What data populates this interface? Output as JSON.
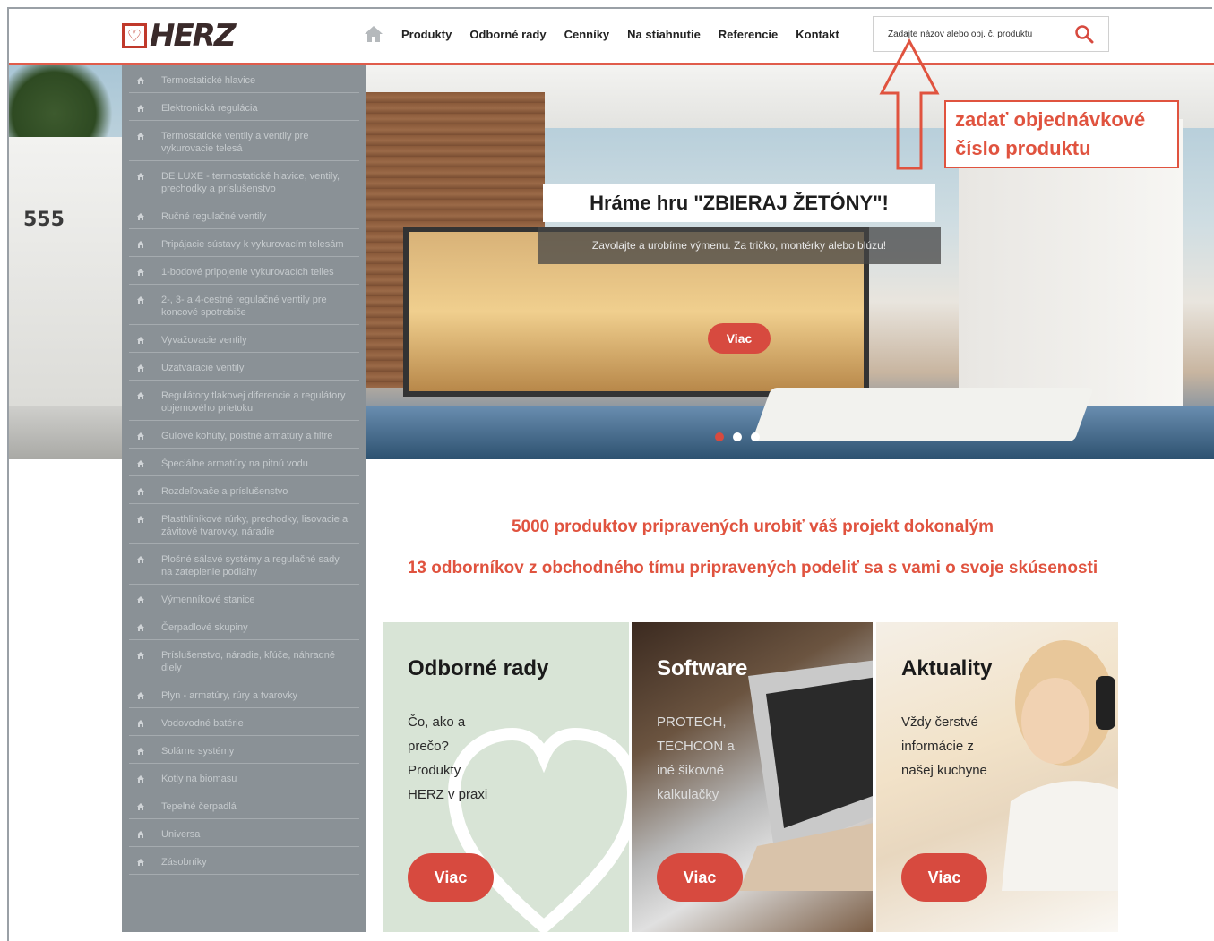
{
  "header": {
    "brand": "HERZ",
    "nav": [
      "Produkty",
      "Odborné rady",
      "Cenníky",
      "Na stiahnutie",
      "Referencie",
      "Kontakt"
    ],
    "search_value": "Zadajte názov alebo obj. č. produktu"
  },
  "hero": {
    "house_number": "555",
    "title": "Hráme hru \"ZBIERAJ ŽETÓNY\"!",
    "subtitle": "Zavolajte a urobíme výmenu. Za tričko, montérky alebo blúzu!",
    "button": "Viac",
    "slides": 3,
    "active_slide": 1
  },
  "annotation": {
    "line1": "zadať objednávkové",
    "line2": "číslo produktu"
  },
  "sidebar": {
    "items": [
      "Termostatické hlavice",
      "Elektronická regulácia",
      "Termostatické ventily a ventily pre vykurovacie telesá",
      "DE LUXE - termostatické hlavice, ventily, prechodky a príslušenstvo",
      "Ručné regulačné ventily",
      "Pripájacie sústavy k vykurovacím telesám",
      "1-bodové pripojenie vykurovacích telies",
      "2-, 3- a 4-cestné regulačné ventily pre koncové spotrebiče",
      "Vyvažovacie ventily",
      "Uzatváracie ventily",
      "Regulátory tlakovej diferencie a regulátory objemového prietoku",
      "Guľové kohúty, poistné armatúry a filtre",
      "Špeciálne armatúry na pitnú vodu",
      "Rozdeľovače a príslušenstvo",
      "Plasthliníkové rúrky, prechodky, lisovacie a závitové tvarovky, náradie",
      "Plošné sálavé systémy a regulačné sady na zateplenie podlahy",
      "Výmenníkové stanice",
      "Čerpadlové skupiny",
      "Príslušenstvo, náradie, kľúče, náhradné diely",
      "Plyn - armatúry, rúry a tvarovky",
      "Vodovodné batérie",
      "Solárne systémy",
      "Kotly na biomasu",
      "Tepelné čerpadlá",
      "Universa",
      "Zásobníky"
    ]
  },
  "main": {
    "tagline1": "5000 produktov pripravených urobiť váš projekt dokonalým",
    "tagline2": "13 odborníkov z obchodného tímu pripravených podeliť sa s vami o svoje skúsenosti",
    "cards": [
      {
        "title": "Odborné rady",
        "text": "Čo, ako a prečo? Produkty HERZ v praxi",
        "button": "Viac"
      },
      {
        "title": "Software",
        "text": "PROTECH, TECHCON a iné šikovné kalkulačky",
        "button": "Viac"
      },
      {
        "title": "Aktuality",
        "text": "Vždy čerstvé informácie z našej kuchyne",
        "button": "Viac"
      }
    ]
  },
  "colors": {
    "accent": "#e0533f",
    "button": "#d74a3f",
    "sidebar": "#8a9196"
  },
  "icons": [
    "home-icon",
    "search-icon",
    "arrow-up-icon",
    "bullet-icon",
    "heart-icon"
  ]
}
